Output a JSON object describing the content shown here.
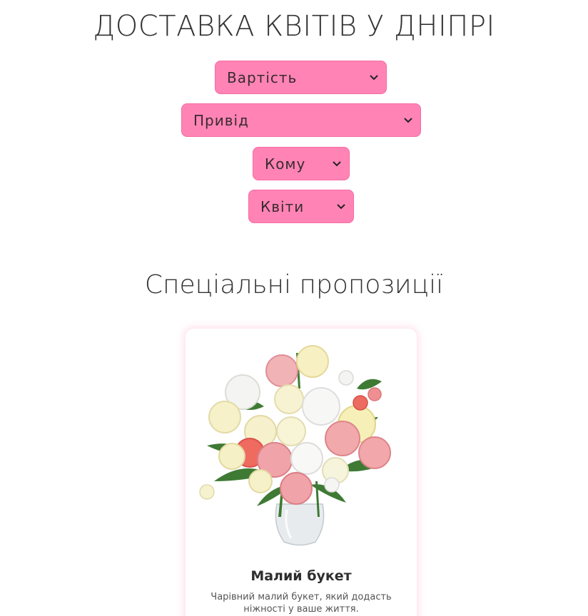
{
  "header": {
    "title": "ДОСТАВКА КВІТІВ У ДНІПРІ"
  },
  "filters": {
    "cost": "Вартість",
    "reason": "Привід",
    "whom": "Кому",
    "flowers": "Квіти"
  },
  "special": {
    "title": "Спеціальні пропозиції",
    "card": {
      "name": "Малий букет",
      "description": "Чарівний малий букет, який додасть ніжності у ваше життя."
    }
  },
  "colors": {
    "accent": "#ff84b5",
    "text": "#333333"
  },
  "icons": {
    "dropdown": "chevron-down-icon"
  }
}
